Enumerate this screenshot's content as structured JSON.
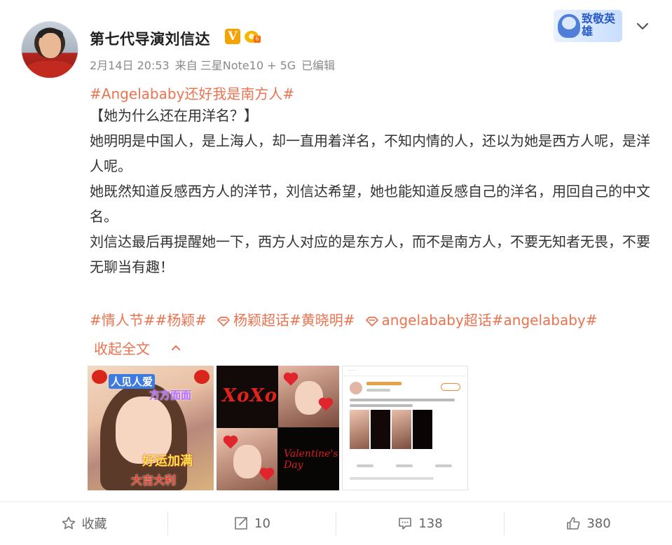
{
  "author": {
    "name": "第七代导演刘信达",
    "verified_badge": "V"
  },
  "meta": {
    "time": "2月14日 20:53",
    "source_prefix": "来自",
    "device": "三星Note10 + 5G",
    "edited": "已编辑"
  },
  "hero_badge": "致敬英雄",
  "post": {
    "topic": "#Angelababy还好我是南方人#",
    "heading": "【她为什么还在用洋名？】",
    "paragraphs": [
      "她明明是中国人，是上海人，却一直用着洋名，不知内情的人，还以为她是西方人呢，是洋人呢。",
      "她既然知道反感西方人的洋节，刘信达希望，她也能知道反感自己的洋名，用回自己的中文名。",
      "刘信达最后再提醒她一下，西方人对应的是东方人，而不是南方人，不要无知者无畏，不要无聊当有趣！"
    ],
    "tags": {
      "tag1": "#情人节#",
      "tag2": "#杨颖#",
      "super1": "杨颖超话",
      "tag3": "#黄晓明#",
      "super2": "angelababy超话",
      "tag4": "#angelababy#"
    },
    "collapse_label": "收起全文"
  },
  "images": {
    "img1_texts": [
      "人见人爱",
      "好运加满",
      "大吉大利",
      "方方面面"
    ],
    "img2_texts": [
      "XoXo",
      "Valentine's Day"
    ]
  },
  "footer": {
    "favorite_label": "收藏",
    "repost_count": "10",
    "comment_count": "138",
    "like_count": "380"
  },
  "colors": {
    "link": "#eb7350",
    "text": "#333333",
    "meta": "#8a8a8a",
    "verified": "#f5a300"
  }
}
